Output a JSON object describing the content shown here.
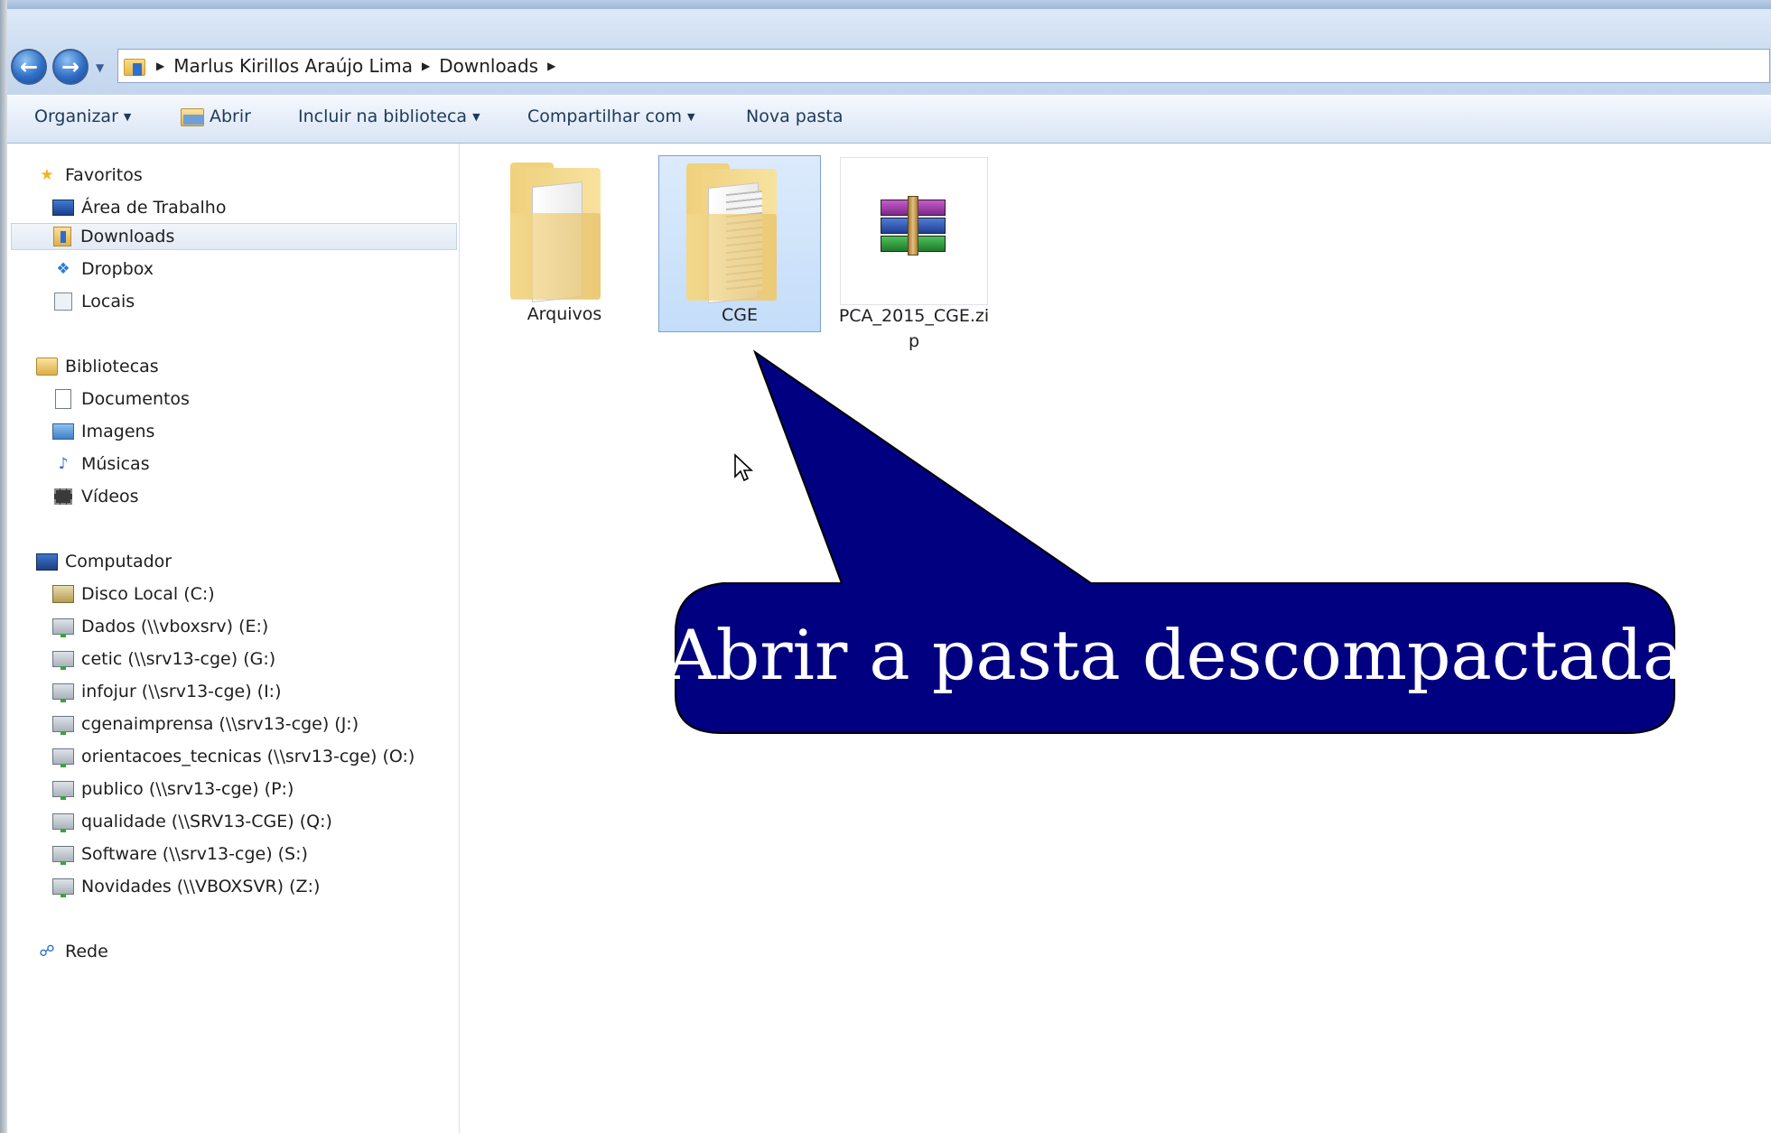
{
  "address": {
    "crumbs": [
      "Marlus Kirillos Araújo Lima",
      "Downloads"
    ]
  },
  "toolbar": {
    "organize": "Organizar",
    "open": "Abrir",
    "include_library": "Incluir na biblioteca",
    "share_with": "Compartilhar com",
    "new_folder": "Nova pasta"
  },
  "sidebar": {
    "favorites": {
      "header": "Favoritos",
      "items": [
        "Área de Trabalho",
        "Downloads",
        "Dropbox",
        "Locais"
      ]
    },
    "libraries": {
      "header": "Bibliotecas",
      "items": [
        "Documentos",
        "Imagens",
        "Músicas",
        "Vídeos"
      ]
    },
    "computer": {
      "header": "Computador",
      "items": [
        "Disco Local (C:)",
        "Dados (\\\\vboxsrv) (E:)",
        "cetic (\\\\srv13-cge) (G:)",
        "infojur (\\\\srv13-cge) (I:)",
        "cgenaimprensa (\\\\srv13-cge) (J:)",
        "orientacoes_tecnicas (\\\\srv13-cge) (O:)",
        "publico (\\\\srv13-cge) (P:)",
        "qualidade (\\\\SRV13-CGE) (Q:)",
        "Software (\\\\srv13-cge) (S:)",
        "Novidades (\\\\VBOXSVR) (Z:)"
      ]
    },
    "network": {
      "header": "Rede"
    },
    "selected": "Downloads"
  },
  "files": [
    {
      "name": "Arquivos",
      "icon": "folder-icon"
    },
    {
      "name": "CGE",
      "icon": "folder-icon",
      "selected": true
    },
    {
      "name_line1": "PCA_2015_CGE.zi",
      "name_line2": "p",
      "icon": "winrar-archive-icon"
    }
  ],
  "callout": {
    "text": "Abrir a pasta descompactada",
    "fill": "#000080",
    "text_color": "#ffffff"
  },
  "colors": {
    "selection": "#c4ddf9",
    "toolbar_text": "#1e395b"
  }
}
